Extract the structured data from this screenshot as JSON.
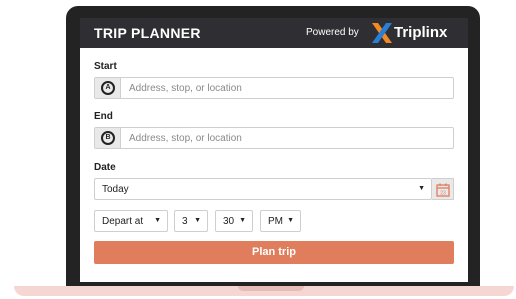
{
  "header": {
    "title": "TRIP PLANNER",
    "powered_by": "Powered by",
    "brand": "Triplinx"
  },
  "start": {
    "label": "Start",
    "pin": "A",
    "placeholder": "Address, stop, or location"
  },
  "end": {
    "label": "End",
    "pin": "B",
    "placeholder": "Address, stop, or location"
  },
  "date": {
    "label": "Date",
    "value": "Today",
    "calendar_icon_day": "23"
  },
  "time": {
    "mode": "Depart at",
    "hour": "3",
    "minute": "30",
    "ampm": "PM"
  },
  "plan_button": "Plan trip",
  "colors": {
    "header_bg": "#2e2e33",
    "accent": "#e07d5c",
    "logo_orange": "#f08a24",
    "logo_blue": "#2a7fd4"
  }
}
